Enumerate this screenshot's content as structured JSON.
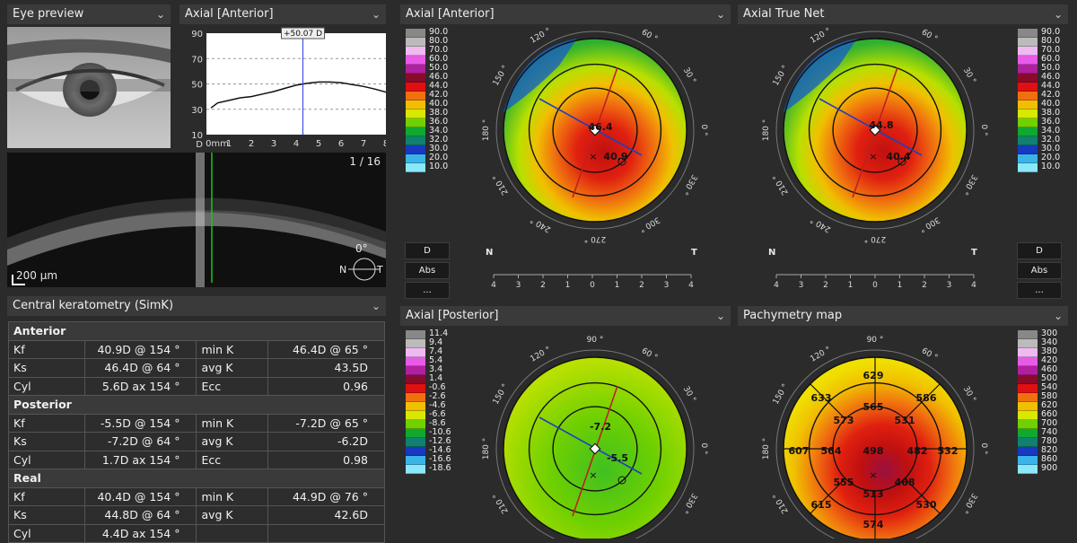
{
  "eye_preview": {
    "title": "Eye preview",
    "chevron": "⌵"
  },
  "axial_profile": {
    "title": "Axial [Anterior]",
    "marker_label": "+50.07 D",
    "chart_data": {
      "type": "line",
      "title": "",
      "xlabel": "",
      "ylabel": "",
      "y_unit": "D",
      "x_unit": "mm",
      "ylim": [
        10,
        90
      ],
      "xlim": [
        0,
        8
      ],
      "y_ticks": [
        "90",
        "70",
        "50",
        "30",
        "10"
      ],
      "x_ticks": [
        "0mm",
        "1",
        "2",
        "3",
        "4",
        "5",
        "6",
        "7",
        "8"
      ],
      "series": [
        {
          "x": [
            0.2,
            0.5,
            1,
            1.5,
            2,
            2.5,
            3,
            3.5,
            4,
            4.5,
            5,
            5.5,
            6,
            6.5,
            7,
            7.5,
            8
          ],
          "y": [
            31,
            35,
            37,
            39,
            40,
            42,
            44,
            46.5,
            49,
            50.5,
            51.5,
            51.5,
            51,
            49.5,
            48,
            46,
            43.5
          ]
        }
      ],
      "marker_x": 4.3
    }
  },
  "oct": {
    "frame": "1 / 16",
    "scale_label": "200 µm",
    "angle": "0°",
    "n_label": "N",
    "t_label": "T"
  },
  "keratometry": {
    "title": "Central keratometry (SimK)",
    "sections": [
      {
        "name": "Anterior",
        "rows": [
          [
            "Kf",
            "40.9D @ 154 °",
            "min K",
            "46.4D @ 65 °"
          ],
          [
            "Ks",
            "46.4D @ 64 °",
            "avg K",
            "43.5D"
          ],
          [
            "Cyl",
            "5.6D ax 154 °",
            "Ecc",
            "0.96"
          ]
        ]
      },
      {
        "name": "Posterior",
        "rows": [
          [
            "Kf",
            "-5.5D @ 154 °",
            "min K",
            "-7.2D @ 65 °"
          ],
          [
            "Ks",
            "-7.2D @ 64 °",
            "avg K",
            "-6.2D"
          ],
          [
            "Cyl",
            "1.7D ax 154 °",
            "Ecc",
            "0.98"
          ]
        ]
      },
      {
        "name": "Real",
        "rows": [
          [
            "Kf",
            "40.4D @ 154 °",
            "min K",
            "44.9D @ 76 °"
          ],
          [
            "Ks",
            "44.8D @ 64 °",
            "avg K",
            "42.6D"
          ],
          [
            "Cyl",
            "4.4D ax 154 °",
            "",
            ""
          ]
        ]
      }
    ]
  },
  "maps": [
    {
      "title": "Axial [Anterior]",
      "values": [
        "46.4",
        "40.9"
      ],
      "n": "N",
      "t": "T"
    },
    {
      "title": "Axial True Net",
      "values": [
        "44.8",
        "40.4"
      ]
    },
    {
      "title": "Axial [Posterior]",
      "values": [
        "-7.2",
        "-5.5"
      ]
    },
    {
      "title": "Pachymetry map",
      "values": [
        "629",
        "633",
        "586",
        "573",
        "565",
        "531",
        "607",
        "564",
        "498",
        "482",
        "532",
        "555",
        "513",
        "468",
        "615",
        "530",
        "574"
      ]
    }
  ],
  "angles": [
    "90 °",
    "60 °",
    "30 °",
    "0 °",
    "330 °",
    "300 °",
    "270 °",
    "240 °",
    "210 °",
    "180 °",
    "150 °",
    "120 °"
  ],
  "ruler_ticks": [
    "4",
    "3",
    "2",
    "1",
    "0",
    "1",
    "2",
    "3",
    "4"
  ],
  "scale_axial": [
    "90.0",
    "80.0",
    "70.0",
    "60.0",
    "50.0",
    "46.0",
    "44.0",
    "42.0",
    "40.0",
    "38.0",
    "36.0",
    "34.0",
    "32.0",
    "30.0",
    "20.0",
    "10.0"
  ],
  "scale_posterior": [
    "11.4",
    "9.4",
    "7.4",
    "5.4",
    "3.4",
    "1.4",
    "-0.6",
    "-2.6",
    "-4.6",
    "-6.6",
    "-8.6",
    "-10.6",
    "-12.6",
    "-14.6",
    "-16.6",
    "-18.6"
  ],
  "scale_pachy": [
    "300",
    "340",
    "380",
    "420",
    "460",
    "500",
    "540",
    "580",
    "620",
    "660",
    "700",
    "740",
    "780",
    "820",
    "860",
    "900"
  ],
  "scale_colors": [
    "#888888",
    "#bbbbbb",
    "#f2b8f2",
    "#e85ae8",
    "#b0209f",
    "#8a0a2a",
    "#e01010",
    "#f07010",
    "#f0c000",
    "#d8e800",
    "#70d000",
    "#10a830",
    "#108070",
    "#1838c0",
    "#3ab4e8",
    "#8ae8f8"
  ],
  "scale_colors_pachy": [
    "#888888",
    "#bbbbbb",
    "#f2b8f2",
    "#e85ae8",
    "#b0209f",
    "#8a0a2a",
    "#e01010",
    "#f07010",
    "#f0c000",
    "#d8e800",
    "#70d000",
    "#10a830",
    "#108070",
    "#1838c0",
    "#3ab4e8",
    "#8ae8f8"
  ],
  "buttons": {
    "d": "D",
    "abs": "Abs",
    "more": "..."
  }
}
